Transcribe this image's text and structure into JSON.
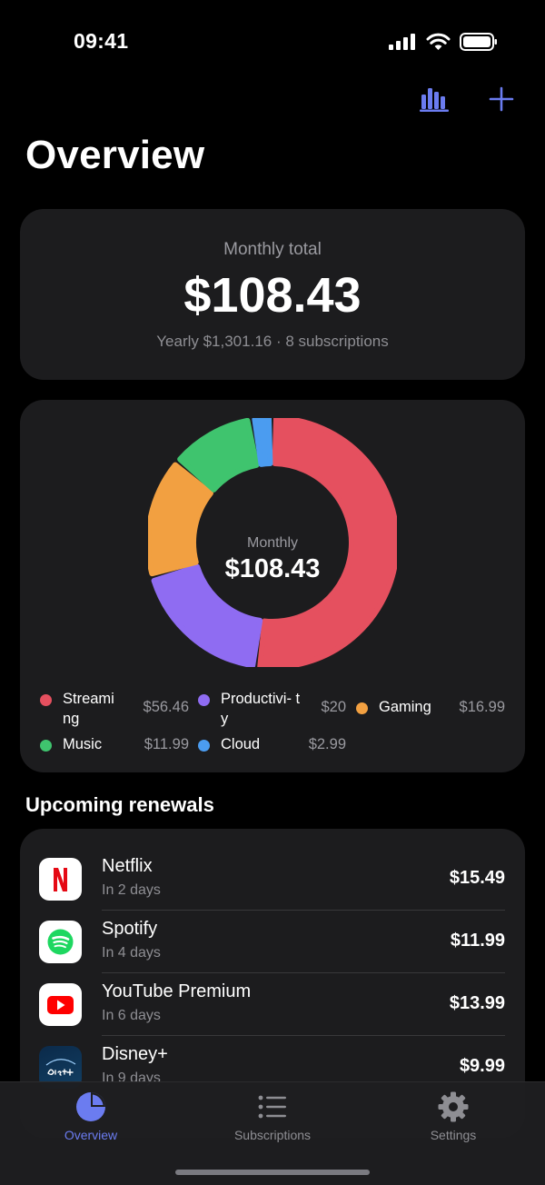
{
  "status_bar": {
    "time": "09:41"
  },
  "header": {
    "title": "Overview",
    "icons": [
      "bar-chart-icon",
      "plus-icon"
    ]
  },
  "summary": {
    "label": "Monthly total",
    "amount": "$108.43",
    "subtitle": "Yearly $1,301.16 · 8 subscriptions"
  },
  "chart_data": {
    "type": "pie",
    "center_label": "Monthly",
    "center_value": "$108.43",
    "series": [
      {
        "name": "Streaming",
        "value": 56.46,
        "display": "$56.46",
        "color": "#e5505f"
      },
      {
        "name": "Productivity",
        "value": 20,
        "display": "$20",
        "color": "#8f6cf2"
      },
      {
        "name": "Gaming",
        "value": 16.99,
        "display": "$16.99",
        "color": "#f2a041"
      },
      {
        "name": "Music",
        "value": 11.99,
        "display": "$11.99",
        "color": "#3fc46e"
      },
      {
        "name": "Cloud",
        "value": 2.99,
        "display": "$2.99",
        "color": "#4b9cf0"
      }
    ]
  },
  "legend": [
    {
      "name": "Streami ng",
      "value": "$56.46"
    },
    {
      "name": "Productivi- ty",
      "value": "$20"
    },
    {
      "name": "Gaming",
      "value": "$16.99"
    },
    {
      "name": "Music",
      "value": "$11.99"
    },
    {
      "name": "Cloud",
      "value": "$2.99"
    }
  ],
  "renewals": {
    "title": "Upcoming renewals",
    "items": [
      {
        "name": "Netflix",
        "due": "In 2 days",
        "price": "$15.49",
        "icon": "netflix-icon"
      },
      {
        "name": "Spotify",
        "due": "In 4 days",
        "price": "$11.99",
        "icon": "spotify-icon"
      },
      {
        "name": "YouTube Premium",
        "due": "In 6 days",
        "price": "$13.99",
        "icon": "youtube-icon"
      },
      {
        "name": "Disney+",
        "due": "In 9 days",
        "price": "$9.99",
        "icon": "disney-plus-icon"
      }
    ]
  },
  "tabs": [
    {
      "label": "Overview",
      "icon": "pie-chart-icon",
      "active": true
    },
    {
      "label": "Subscriptions",
      "icon": "list-icon",
      "active": false
    },
    {
      "label": "Settings",
      "icon": "gear-icon",
      "active": false
    }
  ],
  "colors": {
    "accent": "#6b7cf0",
    "card": "#1c1c1e",
    "background": "#000000"
  }
}
